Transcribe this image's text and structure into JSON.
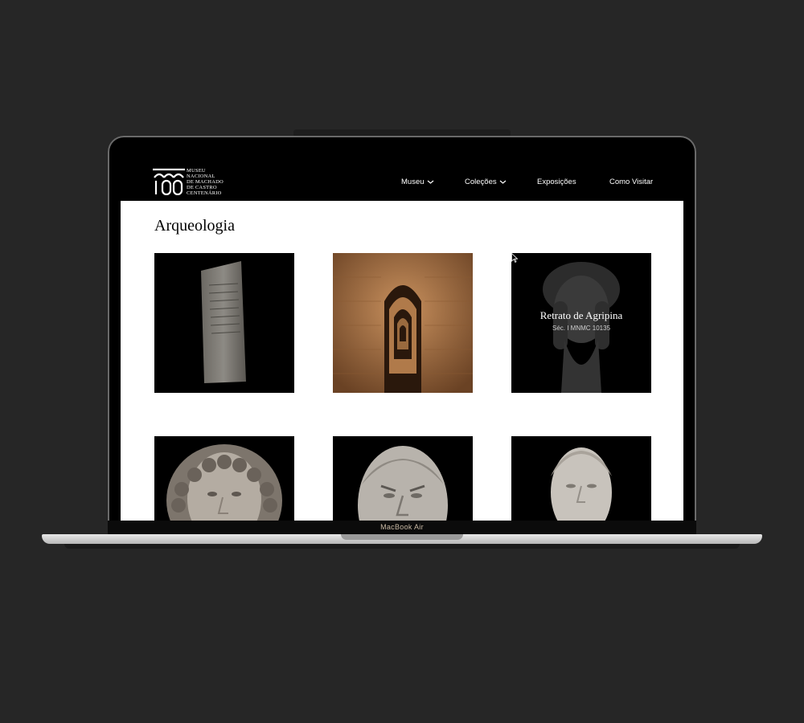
{
  "logo": {
    "lines": [
      "MUSEU",
      "NACIONAL",
      "DE MACHADO",
      "DE CASTRO",
      "CENTENÁRIO"
    ]
  },
  "nav": {
    "items": [
      {
        "label": "Museu",
        "has_dropdown": true
      },
      {
        "label": "Coleções",
        "has_dropdown": true
      },
      {
        "label": "Exposições",
        "has_dropdown": false
      },
      {
        "label": "Como Visitar",
        "has_dropdown": false
      }
    ]
  },
  "page": {
    "title": "Arqueologia"
  },
  "gallery": {
    "hover_item": {
      "title": "Retrato de Agripina",
      "subtitle": "Séc. I MNMC 10135"
    },
    "items": [
      {
        "subject": "inscribed-stone-stele"
      },
      {
        "subject": "cryptoporticus-arches"
      },
      {
        "subject": "portrait-of-agrippina"
      },
      {
        "subject": "female-bust-curled-hair"
      },
      {
        "subject": "male-bust-head"
      },
      {
        "subject": "young-male-bust"
      }
    ]
  },
  "device": {
    "label": "MacBook Air"
  },
  "colors": {
    "background": "#262626",
    "header": "#000000",
    "screen": "#ffffff",
    "label": "#c9b9a4"
  }
}
